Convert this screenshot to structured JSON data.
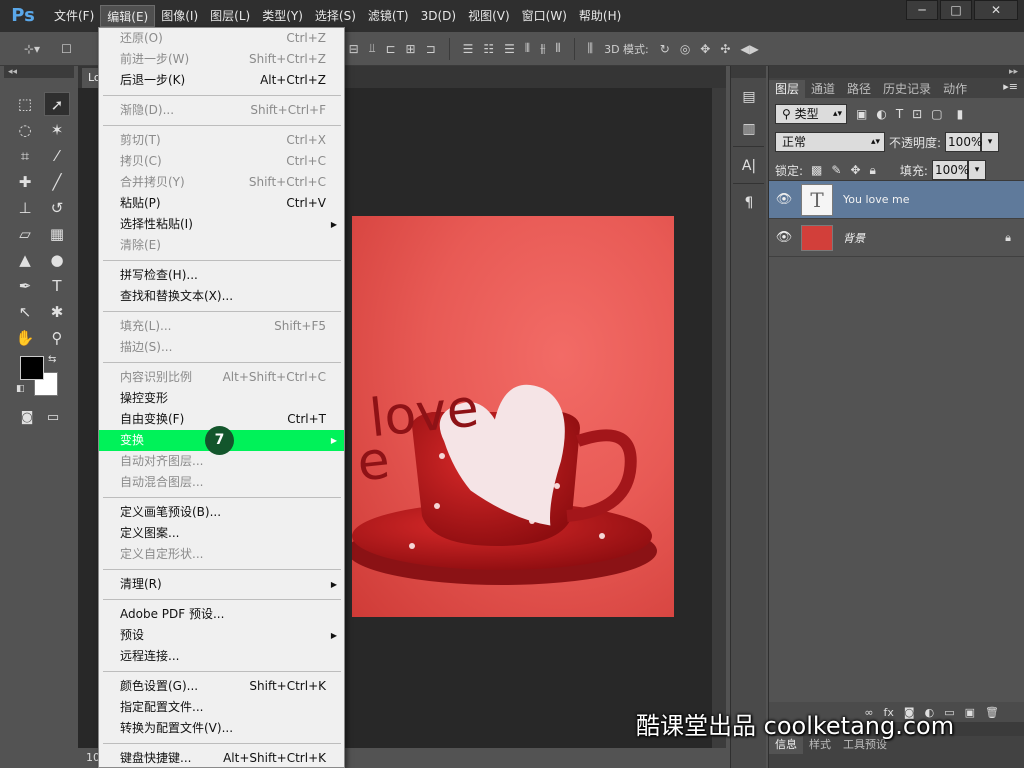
{
  "app": {
    "logo": "Ps"
  },
  "menubar": {
    "items": [
      "文件(F)",
      "编辑(E)",
      "图像(I)",
      "图层(L)",
      "类型(Y)",
      "选择(S)",
      "滤镜(T)",
      "3D(D)",
      "视图(V)",
      "窗口(W)",
      "帮助(H)"
    ],
    "active_index": 1,
    "window_controls": {
      "minimize": "─",
      "maximize": "□",
      "close": "✕"
    }
  },
  "options_bar": {
    "mode_3d_label": "3D 模式:"
  },
  "document": {
    "tab_title": "Lo",
    "status_zoom": "10"
  },
  "edit_menu": {
    "items": [
      {
        "label": "还原(O)",
        "shortcut": "Ctrl+Z",
        "enabled": false
      },
      {
        "label": "前进一步(W)",
        "shortcut": "Shift+Ctrl+Z",
        "enabled": false
      },
      {
        "label": "后退一步(K)",
        "shortcut": "Alt+Ctrl+Z",
        "enabled": true
      },
      {
        "separator": true
      },
      {
        "label": "渐隐(D)...",
        "shortcut": "Shift+Ctrl+F",
        "enabled": false
      },
      {
        "separator": true
      },
      {
        "label": "剪切(T)",
        "shortcut": "Ctrl+X",
        "enabled": false
      },
      {
        "label": "拷贝(C)",
        "shortcut": "Ctrl+C",
        "enabled": false
      },
      {
        "label": "合并拷贝(Y)",
        "shortcut": "Shift+Ctrl+C",
        "enabled": false
      },
      {
        "label": "粘贴(P)",
        "shortcut": "Ctrl+V",
        "enabled": true
      },
      {
        "label": "选择性粘贴(I)",
        "shortcut": "",
        "enabled": true,
        "submenu": true
      },
      {
        "label": "清除(E)",
        "shortcut": "",
        "enabled": false
      },
      {
        "separator": true
      },
      {
        "label": "拼写检查(H)...",
        "shortcut": "",
        "enabled": true
      },
      {
        "label": "查找和替换文本(X)...",
        "shortcut": "",
        "enabled": true
      },
      {
        "separator": true
      },
      {
        "label": "填充(L)...",
        "shortcut": "Shift+F5",
        "enabled": false
      },
      {
        "label": "描边(S)...",
        "shortcut": "",
        "enabled": false
      },
      {
        "separator": true
      },
      {
        "label": "内容识别比例",
        "shortcut": "Alt+Shift+Ctrl+C",
        "enabled": false
      },
      {
        "label": "操控变形",
        "shortcut": "",
        "enabled": true
      },
      {
        "label": "自由变换(F)",
        "shortcut": "Ctrl+T",
        "enabled": true
      },
      {
        "label": "变换",
        "shortcut": "",
        "enabled": true,
        "submenu": true,
        "highlight": true,
        "badge": "7"
      },
      {
        "label": "自动对齐图层...",
        "shortcut": "",
        "enabled": false
      },
      {
        "label": "自动混合图层...",
        "shortcut": "",
        "enabled": false
      },
      {
        "separator": true
      },
      {
        "label": "定义画笔预设(B)...",
        "shortcut": "",
        "enabled": true
      },
      {
        "label": "定义图案...",
        "shortcut": "",
        "enabled": true
      },
      {
        "label": "定义自定形状...",
        "shortcut": "",
        "enabled": false
      },
      {
        "separator": true
      },
      {
        "label": "清理(R)",
        "shortcut": "",
        "enabled": true,
        "submenu": true
      },
      {
        "separator": true
      },
      {
        "label": "Adobe PDF 预设...",
        "shortcut": "",
        "enabled": true
      },
      {
        "label": "预设",
        "shortcut": "",
        "enabled": true,
        "submenu": true
      },
      {
        "label": "远程连接...",
        "shortcut": "",
        "enabled": true
      },
      {
        "separator": true
      },
      {
        "label": "颜色设置(G)...",
        "shortcut": "Shift+Ctrl+K",
        "enabled": true
      },
      {
        "label": "指定配置文件...",
        "shortcut": "",
        "enabled": true
      },
      {
        "label": "转换为配置文件(V)...",
        "shortcut": "",
        "enabled": true
      },
      {
        "separator": true
      },
      {
        "label": "键盘快捷键...",
        "shortcut": "Alt+Shift+Ctrl+K",
        "enabled": true
      }
    ]
  },
  "layers_panel": {
    "tabs": [
      "图层",
      "通道",
      "路径",
      "历史记录",
      "动作"
    ],
    "active_tab": 0,
    "filter_label": "类型",
    "blend_mode": "正常",
    "opacity_label": "不透明度:",
    "opacity_value": "100%",
    "lock_label": "锁定:",
    "fill_label": "填充:",
    "fill_value": "100%",
    "layers": [
      {
        "name": "You love me",
        "kind": "text",
        "thumb": "T",
        "selected": true
      },
      {
        "name": "背景",
        "kind": "image",
        "selected": false,
        "locked": true
      }
    ]
  },
  "lower_panel": {
    "tabs": [
      "信息",
      "样式",
      "工具预设"
    ]
  },
  "canvas_text": {
    "line1": "love",
    "line2": "e"
  },
  "watermark": {
    "text": "酷课堂出品 coolketang.com"
  },
  "colors": {
    "menu_highlight": "#00f259",
    "badge": "#13562c",
    "selected_layer": "#5f7a9b",
    "photo_red": "#e85a55"
  }
}
